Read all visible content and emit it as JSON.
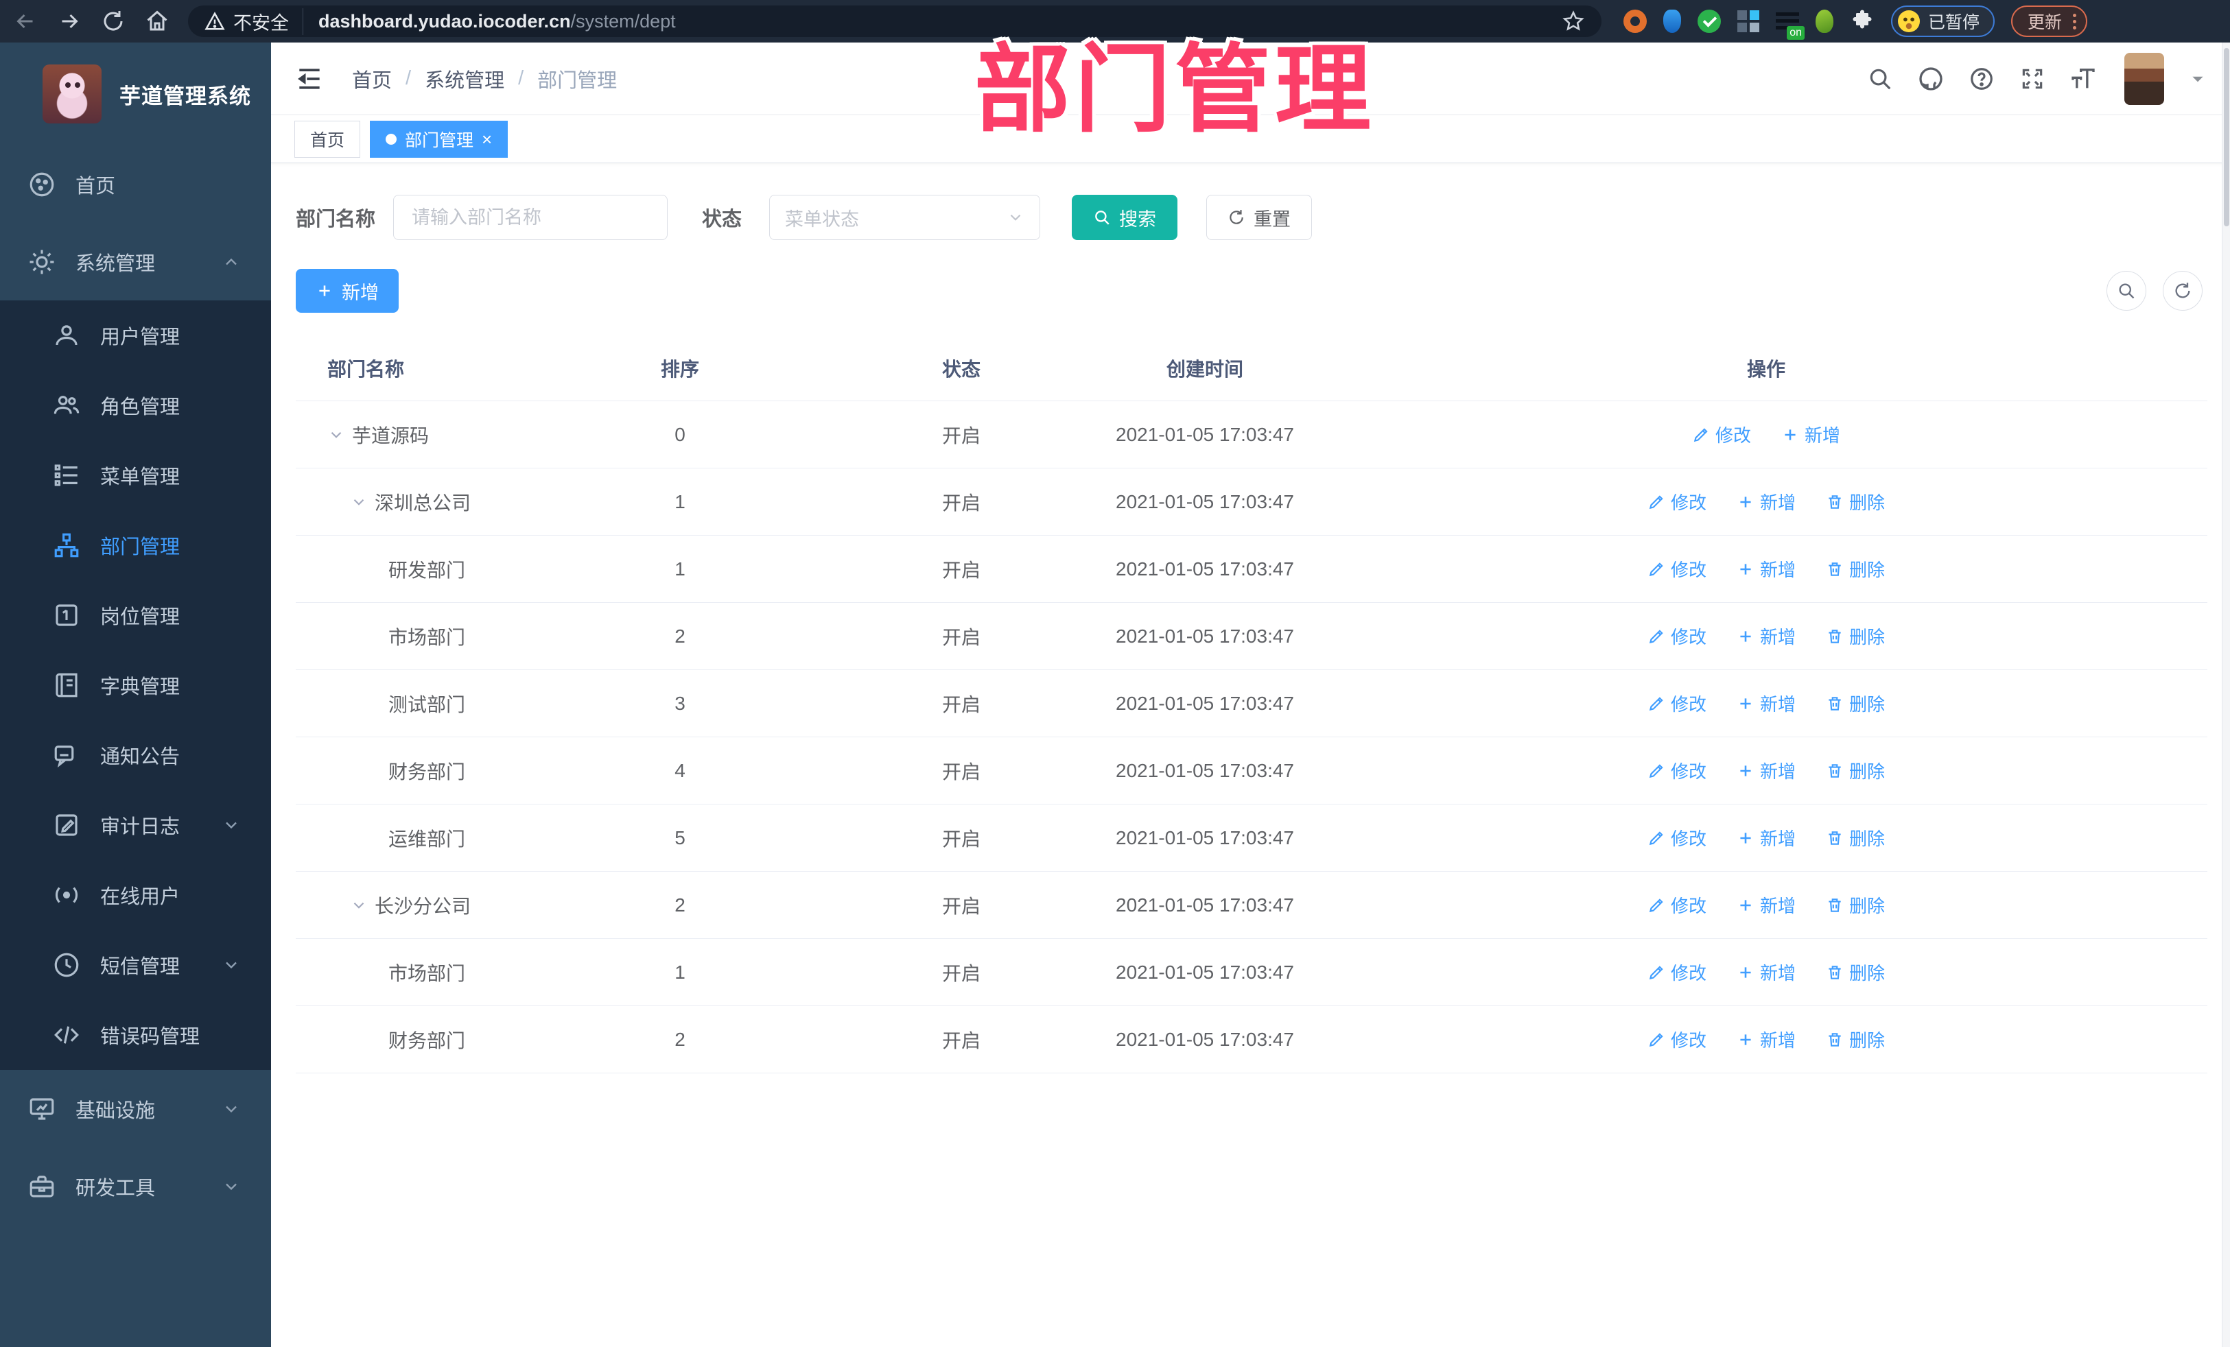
{
  "colors": {
    "primary": "#409eff",
    "search_teal": "#15b5a5",
    "overlay_pink": "#fb3e68",
    "sidebar_bg": "#2c465c",
    "submenu_bg": "#1b2b3e",
    "browser_bg": "#202b3a"
  },
  "overlay": {
    "title": "部门管理"
  },
  "browser": {
    "security_label": "不安全",
    "url_host": "dashboard.yudao.iocoder.cn",
    "url_path": "/system/dept",
    "extension_on_badge": "on",
    "paused_label": "已暂停",
    "update_label": "更新"
  },
  "sidebar": {
    "logo_title": "芋道管理系统",
    "items": [
      {
        "label": "首页",
        "icon": "dashboard-icon"
      },
      {
        "label": "系统管理",
        "icon": "gear-icon",
        "expanded": true,
        "children": [
          {
            "label": "用户管理",
            "icon": "user-icon"
          },
          {
            "label": "角色管理",
            "icon": "users-icon"
          },
          {
            "label": "菜单管理",
            "icon": "menu-list-icon"
          },
          {
            "label": "部门管理",
            "icon": "org-tree-icon",
            "active": true
          },
          {
            "label": "岗位管理",
            "icon": "badge-icon"
          },
          {
            "label": "字典管理",
            "icon": "book-icon"
          },
          {
            "label": "通知公告",
            "icon": "megaphone-icon"
          },
          {
            "label": "审计日志",
            "icon": "log-icon",
            "collapsible": true
          },
          {
            "label": "在线用户",
            "icon": "online-users-icon"
          },
          {
            "label": "短信管理",
            "icon": "sms-icon",
            "collapsible": true
          },
          {
            "label": "错误码管理",
            "icon": "code-icon"
          }
        ]
      },
      {
        "label": "基础设施",
        "icon": "monitor-icon",
        "collapsible": true
      },
      {
        "label": "研发工具",
        "icon": "toolbox-icon",
        "collapsible": true
      }
    ]
  },
  "header": {
    "breadcrumb": [
      "首页",
      "系统管理",
      "部门管理"
    ]
  },
  "tabs": [
    {
      "label": "首页",
      "active": false
    },
    {
      "label": "部门管理",
      "active": true,
      "closable": true
    }
  ],
  "filters": {
    "name_label": "部门名称",
    "name_placeholder": "请输入部门名称",
    "status_label": "状态",
    "status_placeholder": "菜单状态",
    "search_label": "搜索",
    "reset_label": "重置"
  },
  "toolbar": {
    "add_label": "新增"
  },
  "table": {
    "columns": [
      "部门名称",
      "排序",
      "状态",
      "创建时间",
      "操作"
    ],
    "rows": [
      {
        "name": "芋道源码",
        "level": 0,
        "expandable": true,
        "sort": "0",
        "status": "开启",
        "created": "2021-01-05 17:03:47",
        "actions": [
          {
            "label": "修改",
            "icon": "edit-icon"
          },
          {
            "label": "新增",
            "icon": "plus-icon"
          }
        ]
      },
      {
        "name": "深圳总公司",
        "level": 1,
        "expandable": true,
        "sort": "1",
        "status": "开启",
        "created": "2021-01-05 17:03:47",
        "actions": [
          {
            "label": "修改",
            "icon": "edit-icon"
          },
          {
            "label": "新增",
            "icon": "plus-icon"
          },
          {
            "label": "删除",
            "icon": "delete-icon"
          }
        ]
      },
      {
        "name": "研发部门",
        "level": 2,
        "expandable": false,
        "sort": "1",
        "status": "开启",
        "created": "2021-01-05 17:03:47",
        "actions": [
          {
            "label": "修改",
            "icon": "edit-icon"
          },
          {
            "label": "新增",
            "icon": "plus-icon"
          },
          {
            "label": "删除",
            "icon": "delete-icon"
          }
        ]
      },
      {
        "name": "市场部门",
        "level": 2,
        "expandable": false,
        "sort": "2",
        "status": "开启",
        "created": "2021-01-05 17:03:47",
        "actions": [
          {
            "label": "修改",
            "icon": "edit-icon"
          },
          {
            "label": "新增",
            "icon": "plus-icon"
          },
          {
            "label": "删除",
            "icon": "delete-icon"
          }
        ]
      },
      {
        "name": "测试部门",
        "level": 2,
        "expandable": false,
        "sort": "3",
        "status": "开启",
        "created": "2021-01-05 17:03:47",
        "actions": [
          {
            "label": "修改",
            "icon": "edit-icon"
          },
          {
            "label": "新增",
            "icon": "plus-icon"
          },
          {
            "label": "删除",
            "icon": "delete-icon"
          }
        ]
      },
      {
        "name": "财务部门",
        "level": 2,
        "expandable": false,
        "sort": "4",
        "status": "开启",
        "created": "2021-01-05 17:03:47",
        "actions": [
          {
            "label": "修改",
            "icon": "edit-icon"
          },
          {
            "label": "新增",
            "icon": "plus-icon"
          },
          {
            "label": "删除",
            "icon": "delete-icon"
          }
        ]
      },
      {
        "name": "运维部门",
        "level": 2,
        "expandable": false,
        "sort": "5",
        "status": "开启",
        "created": "2021-01-05 17:03:47",
        "actions": [
          {
            "label": "修改",
            "icon": "edit-icon"
          },
          {
            "label": "新增",
            "icon": "plus-icon"
          },
          {
            "label": "删除",
            "icon": "delete-icon"
          }
        ]
      },
      {
        "name": "长沙分公司",
        "level": 1,
        "expandable": true,
        "sort": "2",
        "status": "开启",
        "created": "2021-01-05 17:03:47",
        "actions": [
          {
            "label": "修改",
            "icon": "edit-icon"
          },
          {
            "label": "新增",
            "icon": "plus-icon"
          },
          {
            "label": "删除",
            "icon": "delete-icon"
          }
        ]
      },
      {
        "name": "市场部门",
        "level": 2,
        "expandable": false,
        "sort": "1",
        "status": "开启",
        "created": "2021-01-05 17:03:47",
        "actions": [
          {
            "label": "修改",
            "icon": "edit-icon"
          },
          {
            "label": "新增",
            "icon": "plus-icon"
          },
          {
            "label": "删除",
            "icon": "delete-icon"
          }
        ]
      },
      {
        "name": "财务部门",
        "level": 2,
        "expandable": false,
        "sort": "2",
        "status": "开启",
        "created": "2021-01-05 17:03:47",
        "actions": [
          {
            "label": "修改",
            "icon": "edit-icon"
          },
          {
            "label": "新增",
            "icon": "plus-icon"
          },
          {
            "label": "删除",
            "icon": "delete-icon"
          }
        ]
      }
    ]
  }
}
